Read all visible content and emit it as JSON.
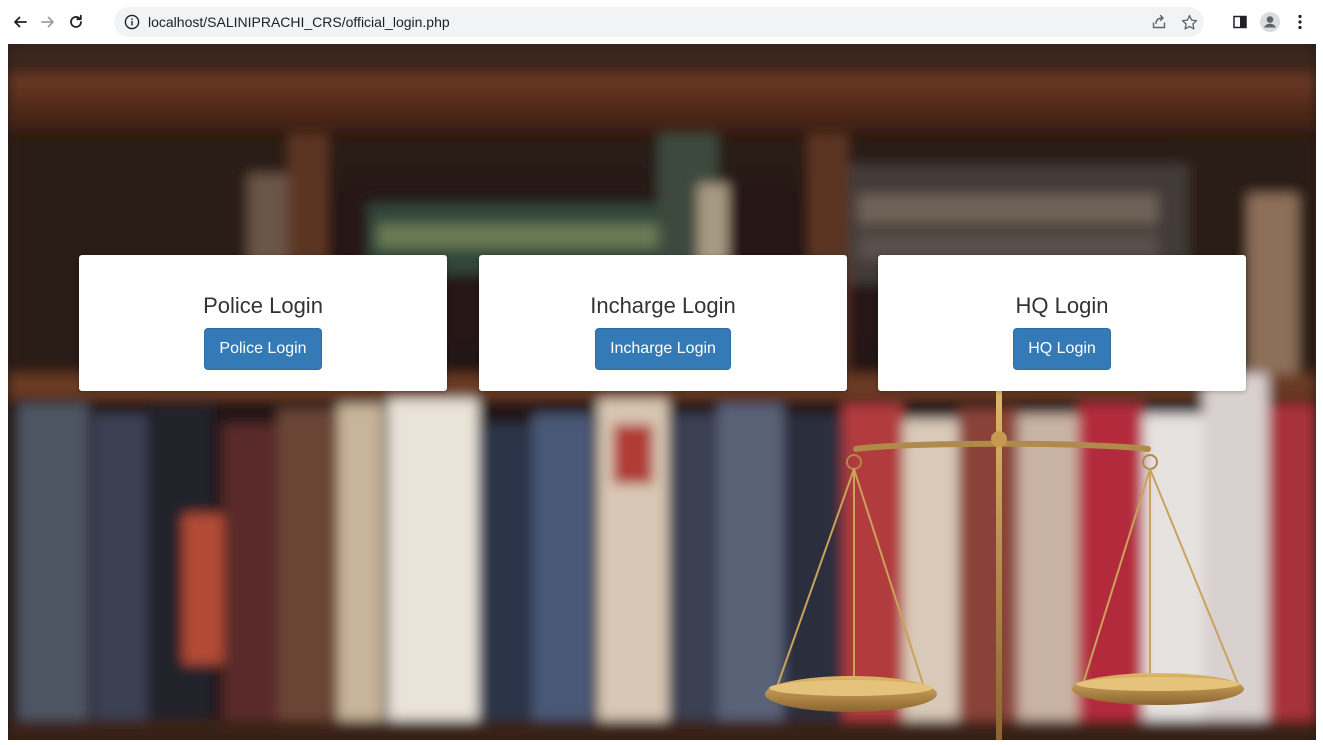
{
  "browser": {
    "url": "localhost/SALINIPRACHI_CRS/official_login.php",
    "icons": {
      "back": "arrow-left-icon",
      "forward": "arrow-right-icon",
      "reload": "reload-icon",
      "info": "info-icon",
      "share": "share-icon",
      "bookmark": "star-icon",
      "sidepanel": "side-panel-icon",
      "profile": "profile-icon",
      "menu": "kebab-menu-icon"
    }
  },
  "cards": [
    {
      "title": "Police Login",
      "button": "Police Login"
    },
    {
      "title": "Incharge Login",
      "button": "Incharge Login"
    },
    {
      "title": "HQ Login",
      "button": "HQ Login"
    }
  ],
  "colors": {
    "button_bg": "#337ab7",
    "button_text": "#ffffff",
    "card_bg": "#ffffff",
    "title_text": "#333333"
  }
}
